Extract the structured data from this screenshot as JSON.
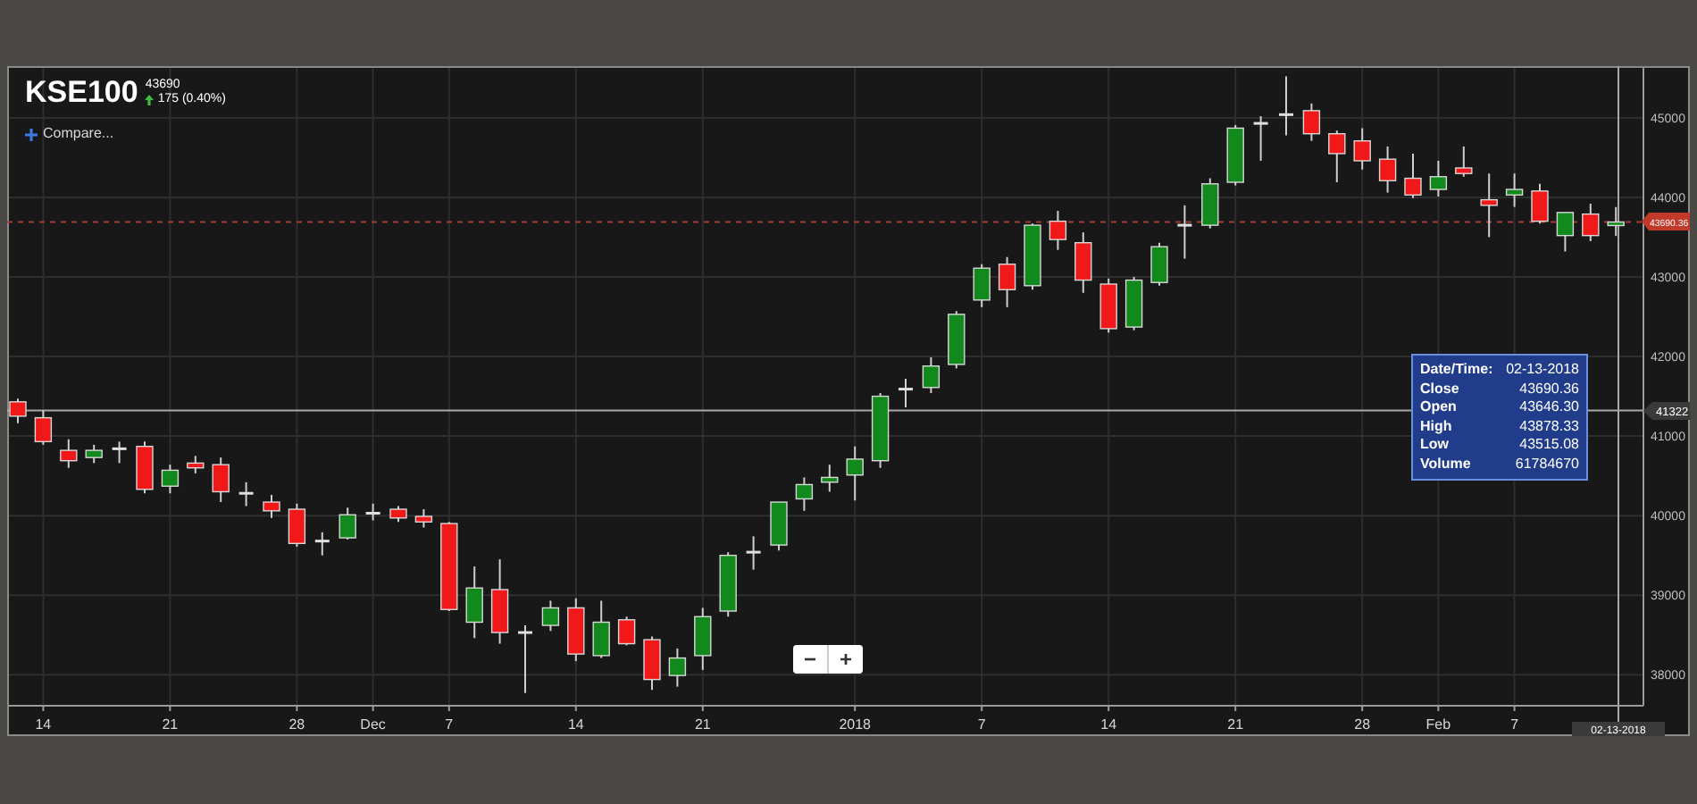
{
  "title": {
    "symbol": "KSE100",
    "price": "43690",
    "change": "175 (0.40%)"
  },
  "compare_button": {
    "label": "Compare..."
  },
  "price_axis": {
    "last_price": "43690.36",
    "crosshair_price": "41322",
    "crosshair_date": "02-13-2018"
  },
  "chart_data": {
    "type": "candlestick",
    "categories": [
      null,
      "14",
      null,
      null,
      null,
      null,
      "21",
      null,
      null,
      null,
      null,
      "28",
      null,
      null,
      "Dec",
      null,
      null,
      "7",
      null,
      null,
      null,
      null,
      "14",
      null,
      null,
      null,
      null,
      "21",
      null,
      null,
      null,
      null,
      null,
      "2018",
      null,
      null,
      null,
      null,
      "7",
      null,
      null,
      null,
      null,
      "14",
      null,
      null,
      null,
      null,
      "21",
      null,
      null,
      null,
      null,
      "28",
      null,
      null,
      "Feb",
      null,
      null,
      "7",
      null,
      null,
      null,
      null
    ],
    "ohlc": [
      [
        41430,
        41470,
        41160,
        41250
      ],
      [
        41230,
        41320,
        40890,
        40930
      ],
      [
        40820,
        40960,
        40600,
        40690
      ],
      [
        40730,
        40890,
        40660,
        40820
      ],
      [
        40840,
        40930,
        40660,
        40840
      ],
      [
        40870,
        40930,
        40280,
        40330
      ],
      [
        40370,
        40640,
        40280,
        40570
      ],
      [
        40660,
        40750,
        40530,
        40600
      ],
      [
        40640,
        40730,
        40170,
        40300
      ],
      [
        40280,
        40420,
        40120,
        40280
      ],
      [
        40170,
        40260,
        39970,
        40060
      ],
      [
        40080,
        40150,
        39610,
        39650
      ],
      [
        39680,
        39790,
        39500,
        39680
      ],
      [
        39720,
        40100,
        39700,
        40010
      ],
      [
        40030,
        40150,
        39940,
        40030
      ],
      [
        40080,
        40120,
        39920,
        39970
      ],
      [
        39990,
        40080,
        39850,
        39920
      ],
      [
        39900,
        39920,
        38800,
        38820
      ],
      [
        38660,
        39360,
        38460,
        39090
      ],
      [
        39070,
        39450,
        38390,
        38530
      ],
      [
        38530,
        38620,
        37770,
        38530
      ],
      [
        38620,
        38930,
        38550,
        38840
      ],
      [
        38840,
        38960,
        38170,
        38260
      ],
      [
        38240,
        38930,
        38210,
        38660
      ],
      [
        38690,
        38730,
        38370,
        38390
      ],
      [
        38440,
        38480,
        37810,
        37940
      ],
      [
        37990,
        38330,
        37850,
        38210
      ],
      [
        38240,
        38840,
        38060,
        38730
      ],
      [
        38800,
        39540,
        38730,
        39500
      ],
      [
        39540,
        39740,
        39320,
        39540
      ],
      [
        39630,
        40170,
        39560,
        40170
      ],
      [
        40210,
        40480,
        40060,
        40390
      ],
      [
        40420,
        40640,
        40300,
        40480
      ],
      [
        40510,
        40870,
        40190,
        40710
      ],
      [
        40690,
        41540,
        40600,
        41500
      ],
      [
        41590,
        41720,
        41360,
        41590
      ],
      [
        41610,
        41990,
        41540,
        41880
      ],
      [
        41900,
        42570,
        41850,
        42530
      ],
      [
        42710,
        43160,
        42620,
        43110
      ],
      [
        43160,
        43250,
        42620,
        42840
      ],
      [
        42890,
        43670,
        42840,
        43650
      ],
      [
        43700,
        43830,
        43340,
        43470
      ],
      [
        43430,
        43560,
        42800,
        42960
      ],
      [
        42910,
        42980,
        42300,
        42350
      ],
      [
        42370,
        43000,
        42330,
        42960
      ],
      [
        42930,
        43430,
        42890,
        43380
      ],
      [
        43650,
        43900,
        43230,
        43650
      ],
      [
        43650,
        44240,
        43610,
        44170
      ],
      [
        44190,
        44910,
        44150,
        44870
      ],
      [
        44930,
        45020,
        44460,
        44930
      ],
      [
        45040,
        45520,
        44780,
        45040
      ],
      [
        45090,
        45180,
        44710,
        44800
      ],
      [
        44800,
        44840,
        44190,
        44550
      ],
      [
        44710,
        44870,
        44350,
        44460
      ],
      [
        44480,
        44640,
        44060,
        44210
      ],
      [
        44240,
        44550,
        43990,
        44030
      ],
      [
        44100,
        44460,
        44010,
        44260
      ],
      [
        44370,
        44640,
        44260,
        44300
      ],
      [
        43970,
        44300,
        43500,
        43900
      ],
      [
        44030,
        44300,
        43880,
        44100
      ],
      [
        44080,
        44170,
        43670,
        43700
      ],
      [
        43520,
        43810,
        43320,
        43810
      ],
      [
        43790,
        43920,
        43450,
        43520
      ],
      [
        43646.3,
        43878.33,
        43515.08,
        43690.36
      ]
    ],
    "ylim": [
      37610,
      45650
    ],
    "grid": true,
    "ref_lines": [
      {
        "axis": "y",
        "value": 43690.36,
        "color": "#a33a30"
      },
      {
        "axis": "y",
        "value": 41322,
        "color": "#a8a8a8"
      }
    ],
    "yticks": [
      45000,
      44000,
      43000,
      42000,
      41000,
      40000,
      39000,
      38000
    ]
  },
  "tooltip": {
    "rows": [
      {
        "label": "Date/Time:",
        "value": "02-13-2018"
      },
      {
        "label": "Close",
        "value": "43690.36"
      },
      {
        "label": "Open",
        "value": "43646.30"
      },
      {
        "label": "High",
        "value": "43878.33"
      },
      {
        "label": "Low",
        "value": "43515.08"
      },
      {
        "label": "Volume",
        "value": "61784670"
      }
    ]
  },
  "zoom_controls": [
    "−",
    "+"
  ]
}
